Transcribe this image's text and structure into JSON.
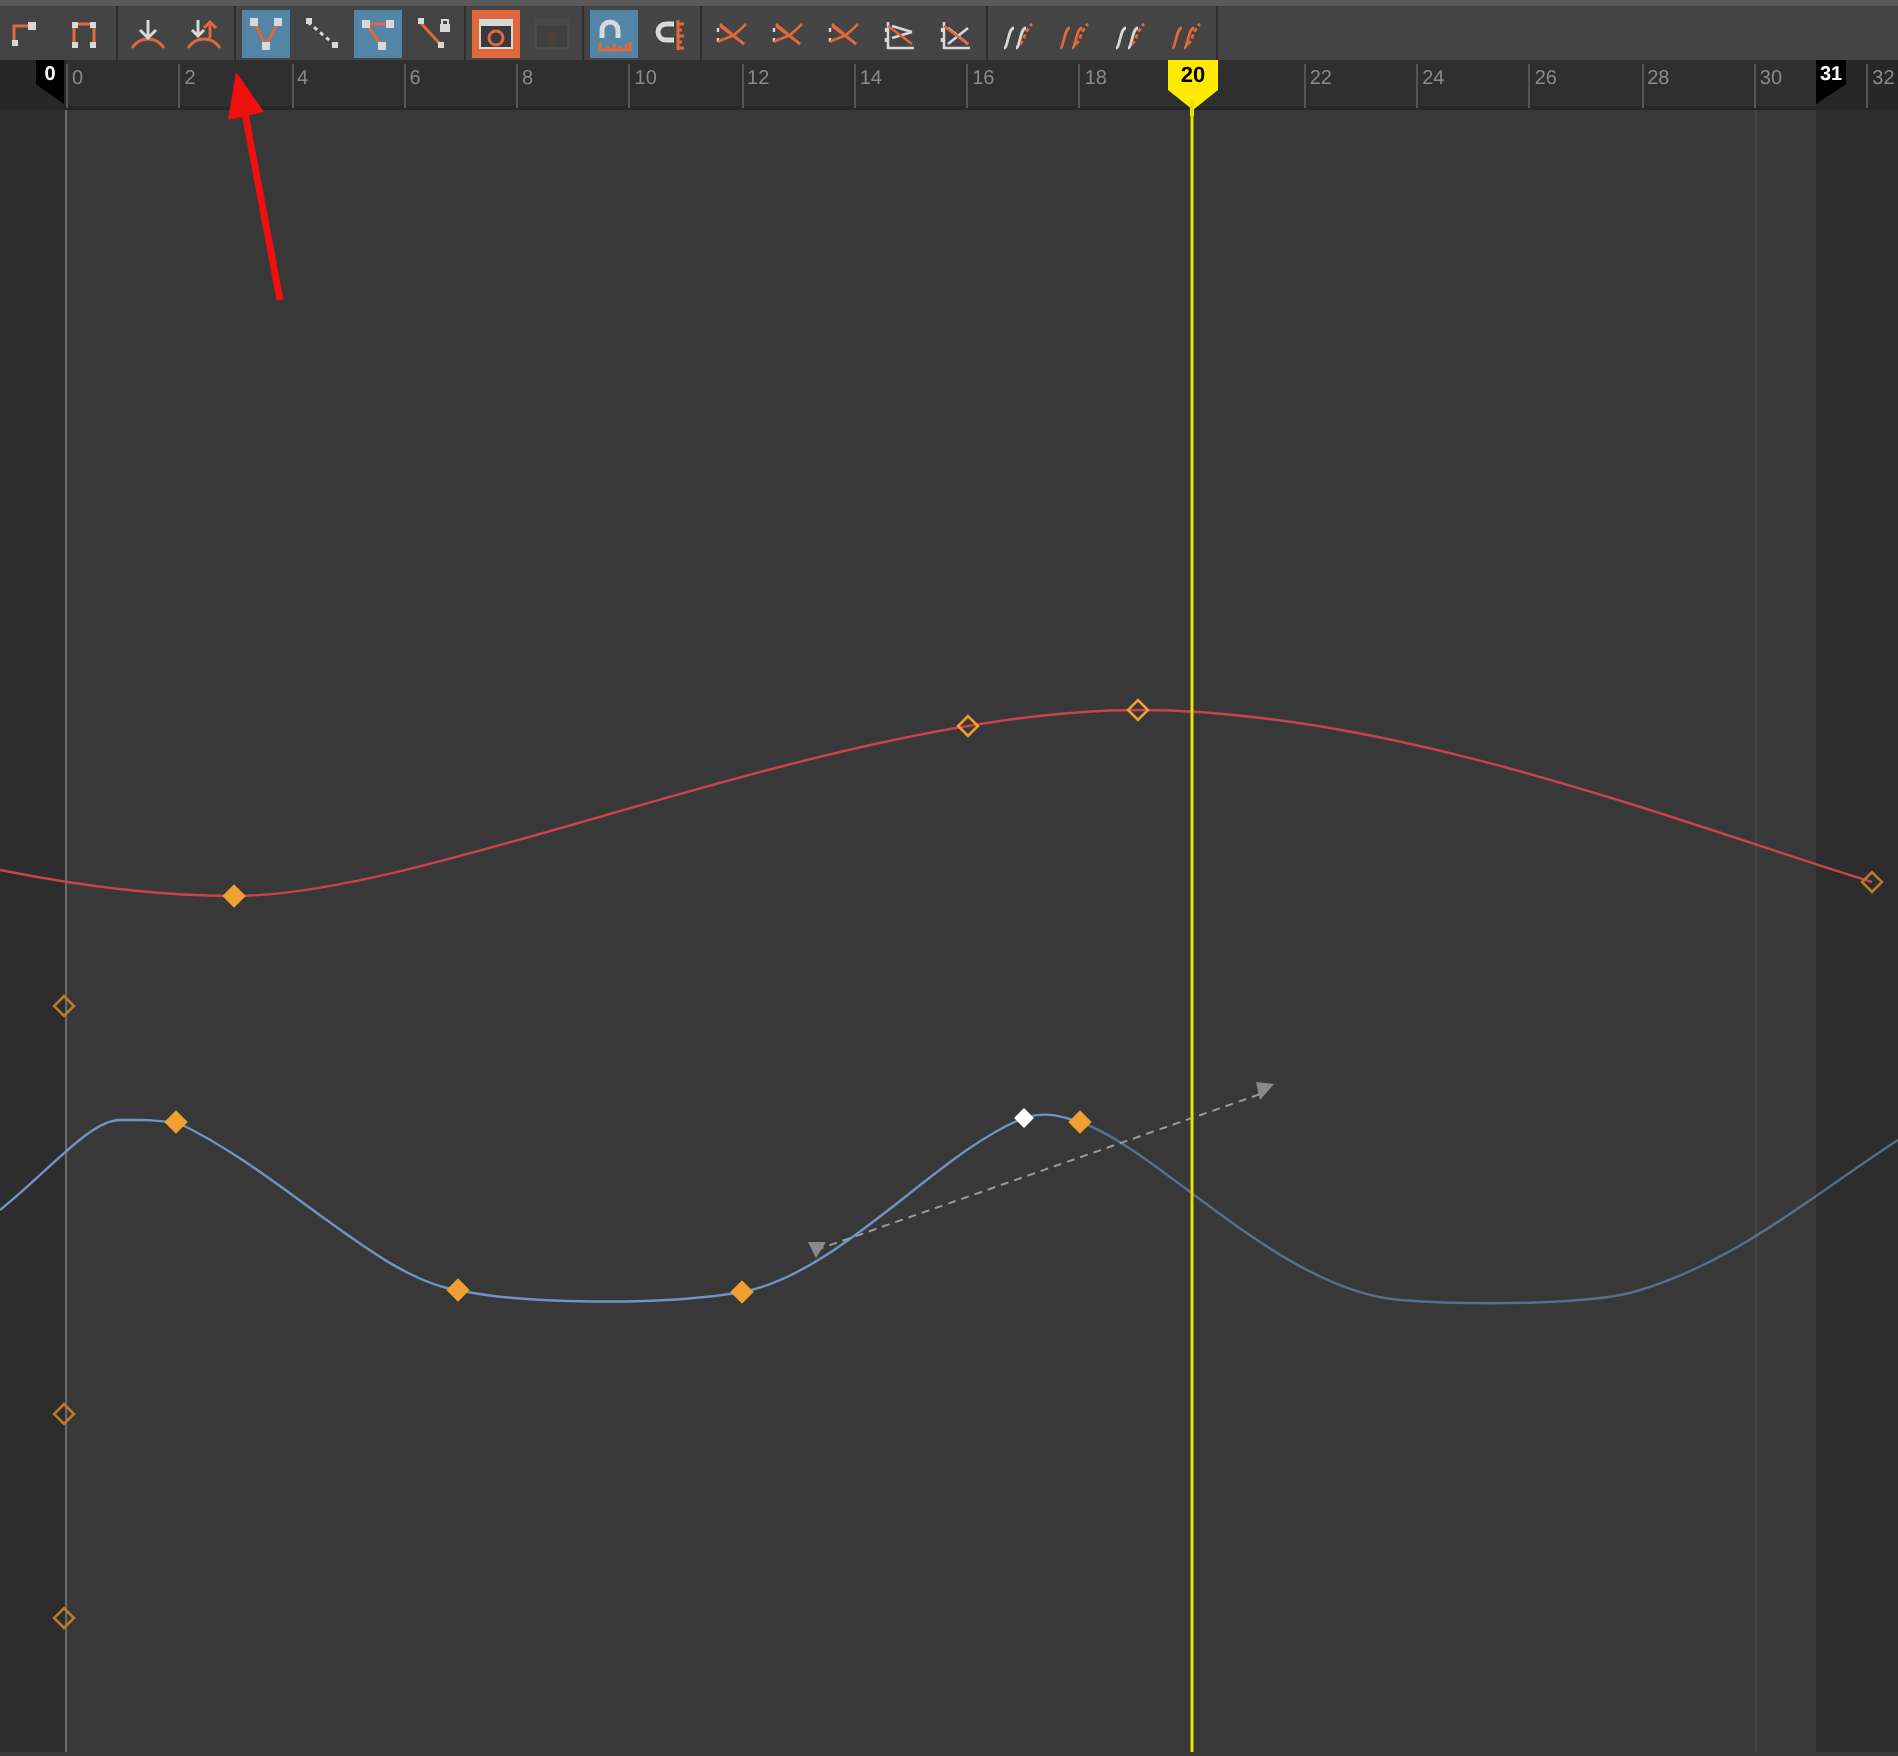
{
  "toolbar": {
    "groups": [
      {
        "buttons": [
          {
            "kind": "snap",
            "selected": false
          },
          {
            "kind": "lattice",
            "selected": false
          }
        ]
      },
      {
        "buttons": [
          {
            "kind": "buffer-down",
            "selected": false
          },
          {
            "kind": "buffer-swap",
            "selected": false
          }
        ]
      },
      {
        "buttons": [
          {
            "kind": "break-tangent",
            "selected": true
          },
          {
            "kind": "unify-tangent",
            "selected": false
          },
          {
            "kind": "free-tangent",
            "selected": true
          },
          {
            "kind": "lock-tangent",
            "selected": false
          }
        ]
      },
      {
        "buttons": [
          {
            "kind": "stacked-view",
            "selected": true
          },
          {
            "kind": "normalize",
            "selected": false,
            "disabled": true
          }
        ]
      },
      {
        "buttons": [
          {
            "kind": "magnet",
            "selected": true
          },
          {
            "kind": "magnet-ruler",
            "selected": false
          }
        ]
      },
      {
        "buttons": [
          {
            "kind": "auto",
            "selected": false
          },
          {
            "kind": "spline",
            "selected": false
          },
          {
            "kind": "clamped",
            "selected": false
          },
          {
            "kind": "linear",
            "selected": false
          },
          {
            "kind": "flat",
            "selected": false
          }
        ]
      },
      {
        "buttons": [
          {
            "kind": "pre-cycle",
            "selected": false
          },
          {
            "kind": "post-cycle",
            "selected": false
          },
          {
            "kind": "cycle-offset",
            "selected": false
          },
          {
            "kind": "offset",
            "selected": false
          }
        ]
      }
    ]
  },
  "ruler": {
    "labels": [
      "0",
      "2",
      "4",
      "6",
      "8",
      "10",
      "12",
      "14",
      "16",
      "18",
      "22",
      "24",
      "26",
      "28",
      "30",
      "32"
    ],
    "markers": [
      {
        "kind": "start",
        "frame": "0"
      },
      {
        "kind": "current",
        "frame": "20"
      },
      {
        "kind": "end",
        "frame": "31"
      }
    ]
  },
  "curves": [
    {
      "color": "#c8434f"
    },
    {
      "color": "#6f93c6"
    }
  ]
}
